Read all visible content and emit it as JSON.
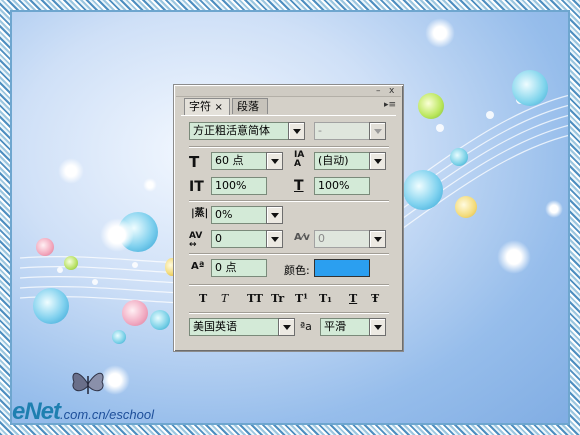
{
  "panel": {
    "tabs": [
      {
        "label": "字符"
      },
      {
        "label": "段落"
      }
    ],
    "tab_close_glyph": "×",
    "titlebar": {
      "minimize_glyph": "–",
      "close_glyph": "x"
    },
    "menu_glyph": "▸≡",
    "font_family": {
      "value": "方正粗活意简体"
    },
    "font_style": {
      "value": "-"
    },
    "font_size": {
      "value": "60 点"
    },
    "leading": {
      "value": "(自动)"
    },
    "vertical_scale": {
      "value": "100%"
    },
    "horizontal_scale": {
      "value": "100%"
    },
    "tsume": {
      "value": "0%"
    },
    "kerning": {
      "value": "0"
    },
    "tracking": {
      "value": "0"
    },
    "baseline_shift": {
      "value": "0 点"
    },
    "color": {
      "label": "颜色:",
      "swatch": "#2b9ff0"
    },
    "style_buttons": [
      "T",
      "T",
      "TT",
      "Tr",
      "T¹",
      "T₁",
      "T",
      "Ŧ"
    ],
    "language": {
      "value": "美国英语"
    },
    "antialias": {
      "icon_text": "ªa",
      "value": "平滑"
    }
  },
  "watermark": {
    "logo": "eNet",
    "url": ".com.cn/eschool"
  },
  "colors": {
    "field_bg": "#d3ead7",
    "panel_bg": "#d4d0c8"
  }
}
